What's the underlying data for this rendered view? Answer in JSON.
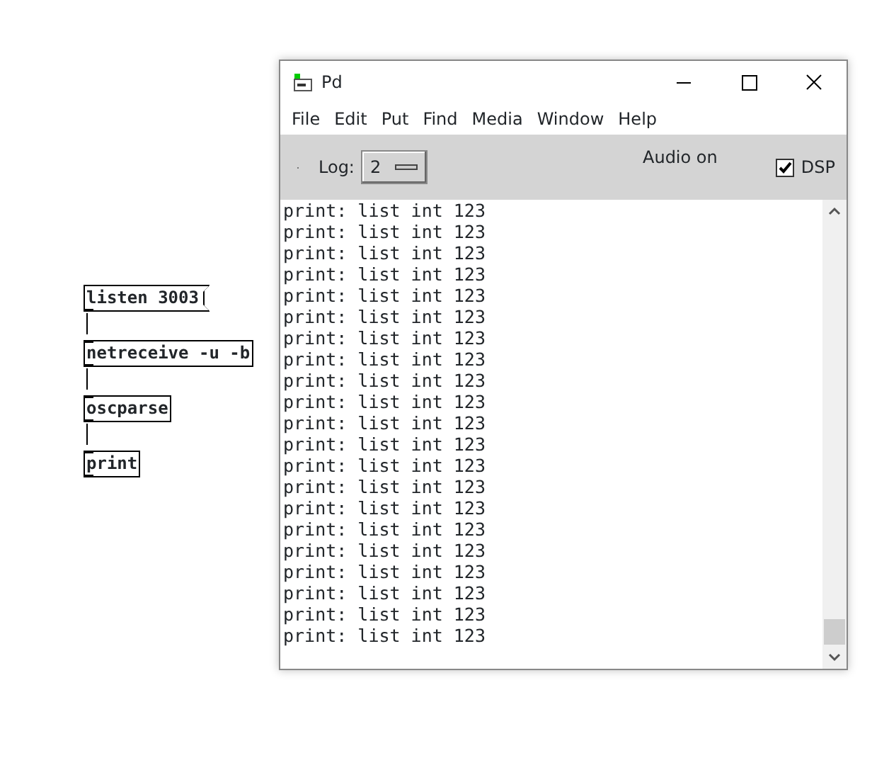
{
  "patch": {
    "boxes": [
      {
        "kind": "message",
        "text": "listen 3003"
      },
      {
        "kind": "object",
        "text": "netreceive -u -b"
      },
      {
        "kind": "object",
        "text": "oscparse"
      },
      {
        "kind": "object",
        "text": "print"
      }
    ]
  },
  "window": {
    "title": "Pd",
    "menu": [
      "File",
      "Edit",
      "Put",
      "Find",
      "Media",
      "Window",
      "Help"
    ],
    "toolbar": {
      "log_label": "Log:",
      "log_value": "2",
      "audio_status": "Audio on",
      "dsp": {
        "label": "DSP",
        "checked": true
      }
    },
    "console": [
      "print: list int 123",
      "print: list int 123",
      "print: list int 123",
      "print: list int 123",
      "print: list int 123",
      "print: list int 123",
      "print: list int 123",
      "print: list int 123",
      "print: list int 123",
      "print: list int 123",
      "print: list int 123",
      "print: list int 123",
      "print: list int 123",
      "print: list int 123",
      "print: list int 123",
      "print: list int 123",
      "print: list int 123",
      "print: list int 123",
      "print: list int 123",
      "print: list int 123",
      "print: list int 123"
    ]
  }
}
